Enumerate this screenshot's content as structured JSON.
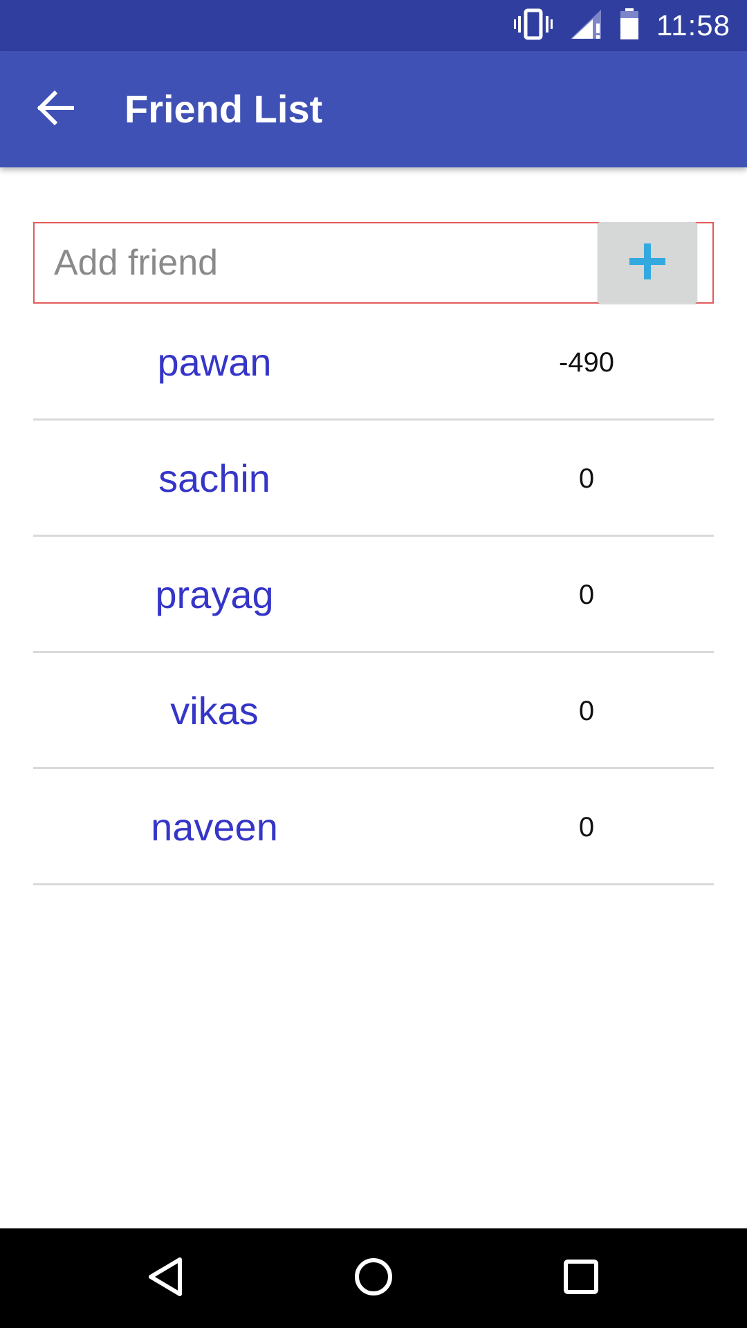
{
  "status_bar": {
    "time": "11:58",
    "icons": [
      "vibrate-icon",
      "signal-icon",
      "battery-icon"
    ],
    "background": "#303F9F"
  },
  "app_bar": {
    "title": "Friend List",
    "back_icon": "arrow-back-icon",
    "background": "#3F51B5"
  },
  "add_friend": {
    "placeholder": "Add friend",
    "value": "",
    "button_icon": "plus-icon",
    "border_color": "#E35B5B",
    "icon_color": "#33A9E0"
  },
  "friends": [
    {
      "name": "pawan",
      "balance": "-490"
    },
    {
      "name": "sachin",
      "balance": "0"
    },
    {
      "name": "prayag",
      "balance": "0"
    },
    {
      "name": "vikas",
      "balance": "0"
    },
    {
      "name": "naveen",
      "balance": "0"
    }
  ],
  "nav_bar": {
    "buttons": [
      "back-triangle-icon",
      "home-circle-icon",
      "recents-square-icon"
    ]
  },
  "colors": {
    "friend_name": "#3535C8",
    "divider": "#d9d9d9"
  }
}
